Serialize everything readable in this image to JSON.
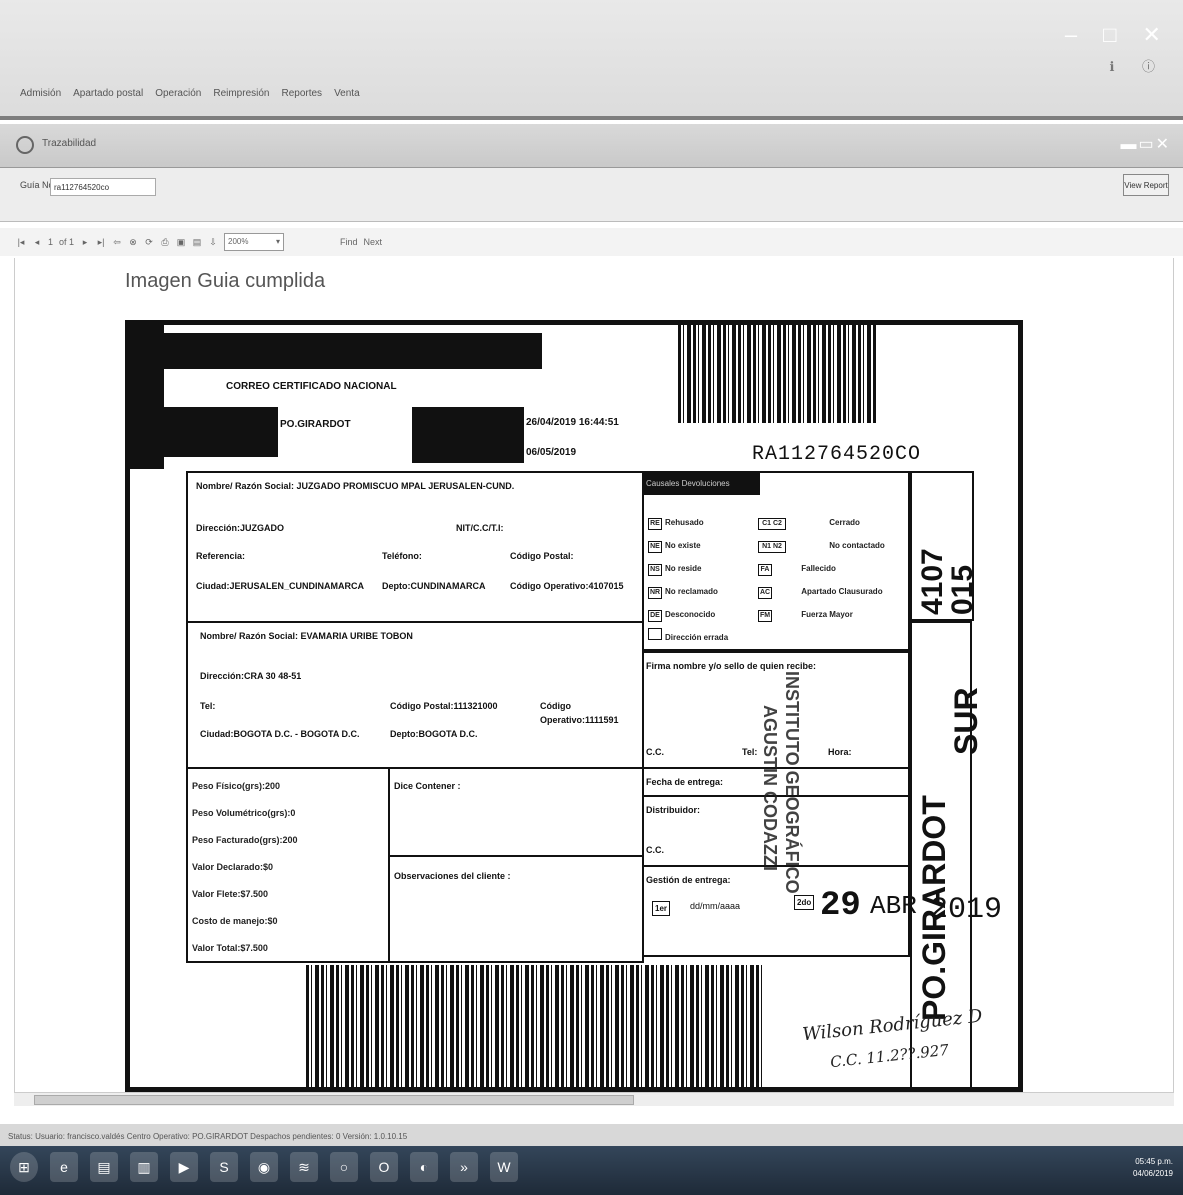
{
  "menu": [
    "Admisión",
    "Apartado postal",
    "Operación",
    "Reimpresión",
    "Reportes",
    "Venta"
  ],
  "subwindow": {
    "title": "Trazabilidad"
  },
  "guia": {
    "label": "Guía No.",
    "value": "ra112764520co",
    "view_report": "View Report"
  },
  "toolbar": {
    "page": "1",
    "of": "of 1",
    "zoom": "200%",
    "find": "Find",
    "next": "Next"
  },
  "report": {
    "title": "Imagen Guia cumplida"
  },
  "label": {
    "service": "CORREO CERTIFICADO NACIONAL",
    "origin": "PO.GIRARDOT",
    "date1": "26/04/2019 16:44:51",
    "date2": "06/05/2019",
    "tracking": "RA112764520CO",
    "dest_name": "Nombre/ Razón Social: JUZGADO PROMISCUO MPAL JERUSALEN-CUND.",
    "dest_dir": "Dirección:JUZGADO",
    "dest_nit": "NIT/C.C/T.I:",
    "dest_ref": "Referencia:",
    "dest_tel": "Teléfono:",
    "dest_cp": "Código Postal:",
    "dest_city": "Ciudad:JERUSALEN_CUNDINAMARCA",
    "dest_depto": "Depto:CUNDINAMARCA",
    "dest_op": "Código Operativo:4107015",
    "rem_name": "Nombre/ Razón Social: EVAMARIA URIBE TOBON",
    "rem_dir": "Dirección:CRA 30  48-51",
    "rem_tel": "Tel:",
    "rem_cp": "Código Postal:111321000",
    "rem_op_label": "Código",
    "rem_op": "Operativo:1111591",
    "rem_city": "Ciudad:BOGOTA D.C. - BOGOTA D.C.",
    "rem_depto": "Depto:BOGOTA D.C.",
    "peso_fisico": "Peso Físico(grs):200",
    "peso_vol": "Peso Volumétrico(grs):0",
    "peso_fact": "Peso Facturado(grs):200",
    "valor_decl": "Valor Declarado:$0",
    "valor_flete": "Valor Flete:$7.500",
    "costo_manejo": "Costo de manejo:$0",
    "valor_total": "Valor Total:$7.500",
    "dice_contener": "Dice Contener :",
    "observaciones": "Observaciones del cliente :",
    "causales_header": "Causales Devoluciones",
    "causales": [
      {
        "code": "RE",
        "text": "Rehusado"
      },
      {
        "code": "NE",
        "text": "No existe"
      },
      {
        "code": "NS",
        "text": "No reside"
      },
      {
        "code": "NR",
        "text": "No reclamado"
      },
      {
        "code": "DE",
        "text": "Desconocido"
      },
      {
        "code": "",
        "text": "Dirección errada"
      }
    ],
    "causales2": [
      {
        "code": "C1 C2",
        "text": "Cerrado"
      },
      {
        "code": "N1 N2",
        "text": "No contactado"
      },
      {
        "code": "FA",
        "text": "Fallecido"
      },
      {
        "code": "AC",
        "text": "Apartado Clausurado"
      },
      {
        "code": "FM",
        "text": "Fuerza Mayor"
      }
    ],
    "firma": "Firma nombre y/o sello de quien recibe:",
    "cc": "C.C.",
    "tel": "Tel:",
    "hora": "Hora:",
    "fecha_entrega": "Fecha de entrega:",
    "fecha_fmt": "dd/mm/aaaa",
    "distribuidor": "Distribuidor:",
    "gestion": "Gestión de entrega:",
    "primer": "1er",
    "segundo": "2do",
    "stamp_date": "29",
    "stamp_month": "ABR",
    "stamp_year": "2019",
    "op_code_1": "4107",
    "op_code_2": "015",
    "office": "PO.GIRARDOT",
    "office_sur": "SUR",
    "stamp_text_1": "INSTITUTO GEOGRÁFICO",
    "stamp_text_2": "AGUSTIN CODAZZI",
    "signature": "Wilson Rodríguez D",
    "signature_cc": "C.C. 11.2??.927"
  },
  "status": "Status: Usuario: francisco.valdés  Centro Operativo: PO.GIRARDOT  Despachos pendientes: 0  Versión: 1.0.10.15",
  "clock": {
    "time": "05:45 p.m.",
    "date": "04/06/2019"
  },
  "taskbar_icons": [
    "start-icon",
    "ie-icon",
    "explorer-icon",
    "files-icon",
    "media-icon",
    "skype-icon",
    "chrome-icon",
    "spotify-icon",
    "app-icon",
    "outlook-icon",
    "browser-icon",
    "arrow-icon",
    "word-icon"
  ]
}
